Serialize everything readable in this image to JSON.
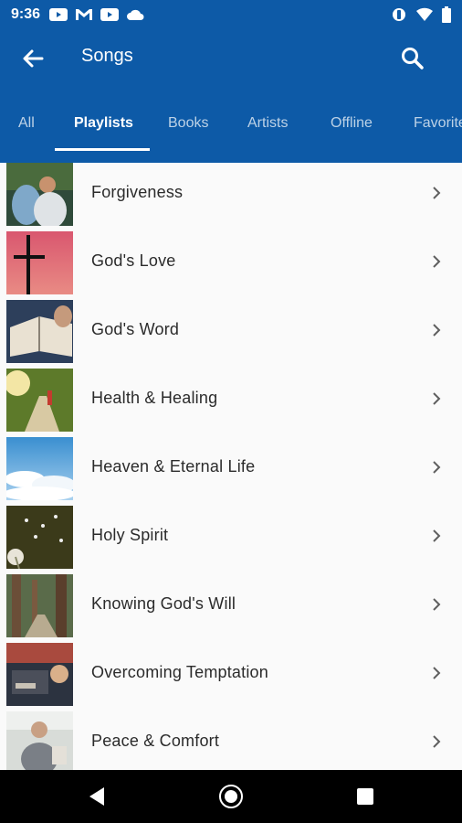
{
  "status_bar": {
    "time": "9:36",
    "left_icons": [
      "youtube-icon",
      "gmail-icon",
      "youtube-icon",
      "cloud-icon"
    ],
    "right_icons": [
      "vibrate-icon",
      "wifi-icon",
      "battery-icon"
    ]
  },
  "app_bar": {
    "title": "Songs",
    "back_icon": "arrow-back-icon",
    "search_icon": "search-icon"
  },
  "tabs": [
    {
      "label": "All",
      "active": false
    },
    {
      "label": "Playlists",
      "active": true
    },
    {
      "label": "Books",
      "active": false
    },
    {
      "label": "Artists",
      "active": false
    },
    {
      "label": "Offline",
      "active": false
    },
    {
      "label": "Favorites",
      "active": false
    }
  ],
  "playlists": [
    {
      "title": "Forgiveness"
    },
    {
      "title": "God's Love"
    },
    {
      "title": "God's Word"
    },
    {
      "title": "Health & Healing"
    },
    {
      "title": "Heaven & Eternal Life"
    },
    {
      "title": "Holy Spirit"
    },
    {
      "title": "Knowing God's Will"
    },
    {
      "title": "Overcoming Temptation"
    },
    {
      "title": "Peace & Comfort"
    }
  ],
  "colors": {
    "primary": "#0d5aa7",
    "list_background": "#fafafa",
    "text": "#2b2b2b",
    "chevron": "#5f5f5f"
  },
  "nav_bar": [
    "back-triangle-icon",
    "home-circle-icon",
    "recents-square-icon"
  ]
}
